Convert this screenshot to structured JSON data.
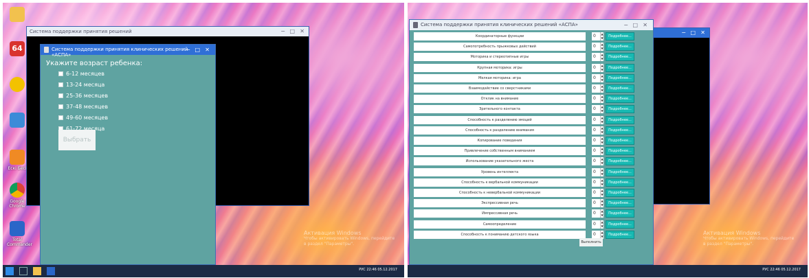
{
  "left": {
    "desktop_icons": [
      {
        "label": "",
        "icon": "folder-icon"
      },
      {
        "label": "",
        "icon": "app-64-icon"
      },
      {
        "label": "",
        "icon": "app-icon"
      },
      {
        "label": "",
        "icon": "app-icon"
      },
      {
        "label": "Ескі Бесі",
        "icon": "app-icon"
      },
      {
        "label": "Google Chrome",
        "icon": "chrome-icon"
      },
      {
        "label": "Total Commander",
        "icon": "floppy-icon"
      }
    ],
    "bg_window_title": "Cистема поддержки принятия решений",
    "app_title": "Система поддержки принятия клинических решений «АСПА»",
    "prompt": "Укажите возраст ребенка:",
    "options": [
      "6-12 месяцев",
      "13-24 месяца",
      "25-36 месяцев",
      "37-48 месяцев",
      "49-60 месяцев",
      "61-72 месяца"
    ],
    "button": "Выбрать",
    "watermark": [
      "Активация Windows",
      "Чтобы активировать Windows, перейдите",
      "в раздел \"Параметры\"."
    ]
  },
  "right": {
    "app_title": "Система поддержки принятия клинических решений «АСПА»",
    "rows": [
      "Координаторные функции",
      "Самопотребность прыжковых действий",
      "Моторика и стереотипные игры",
      "Крупная моторика: игры",
      "Мелкая моторика: игра",
      "Взаимодействие со сверстниками",
      "Отклик на внимание",
      "Зрительного контакта",
      "Способность к разделению эмоций",
      "Способность к разделению внимания",
      "Копирование поведения",
      "Привлечение собственным вниманием",
      "Использование указательного жеста",
      "Уровень интеллекта",
      "Способность к вербальной коммуникации",
      "Способность к невербальной коммуникации",
      "Экспрессивная речь",
      "Импрессивная речь",
      "Самоопределение",
      "Способность к пониманию детского языка"
    ],
    "spin_value": "0",
    "more_label": "Подробнее...",
    "execute": "Выполнить",
    "watermark": [
      "Активация Windows",
      "Чтобы активировать Windows, перейдите",
      "в раздел \"Параметры\"."
    ]
  },
  "taskbar": {
    "lang": "РУС",
    "time": "22:46",
    "date": "05.12.2017"
  }
}
